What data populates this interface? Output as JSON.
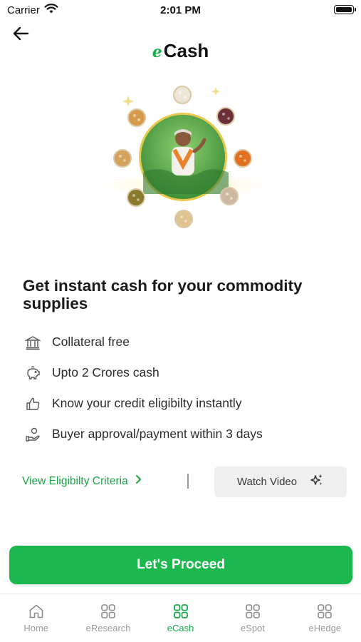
{
  "status_bar": {
    "carrier": "Carrier",
    "time": "2:01 PM"
  },
  "header": {
    "brand_prefix": "e",
    "brand_name": "Cash"
  },
  "headline": "Get instant cash for your commodity supplies",
  "features": [
    {
      "icon": "bank-icon",
      "text": "Collateral free"
    },
    {
      "icon": "piggy-bank-icon",
      "text": "Upto 2 Crores cash"
    },
    {
      "icon": "thumbs-up-icon",
      "text": "Know your credit eligibilty instantly"
    },
    {
      "icon": "hand-coin-icon",
      "text": "Buyer approval/payment within 3 days"
    }
  ],
  "actions": {
    "eligibility_link": "View Eligibilty Criteria",
    "watch_video": "Watch Video"
  },
  "proceed_button": "Let's Proceed",
  "tabbar": {
    "active": "eCash",
    "tabs": [
      {
        "label": "Home",
        "icon": "home-icon"
      },
      {
        "label": "eResearch",
        "icon": "grid-icon"
      },
      {
        "label": "eCash",
        "icon": "grid-icon"
      },
      {
        "label": "eSpot",
        "icon": "grid-icon"
      },
      {
        "label": "eHedge",
        "icon": "grid-icon"
      }
    ]
  },
  "colors": {
    "brand_green": "#1cb84f",
    "link_green": "#19a347",
    "inactive_gray": "#9a9a9a"
  }
}
